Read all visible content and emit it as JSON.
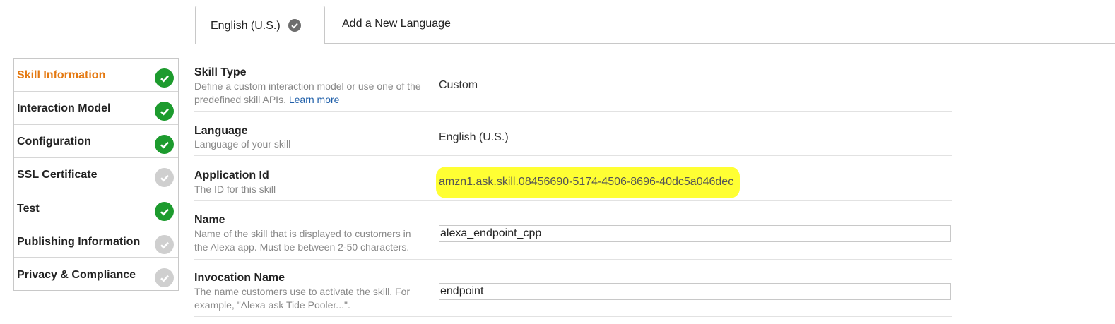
{
  "tabs": {
    "active_label": "English (U.S.)",
    "add_label": "Add a New Language"
  },
  "sidebar": {
    "items": [
      {
        "label": "Skill Information",
        "status": "complete",
        "active": true
      },
      {
        "label": "Interaction Model",
        "status": "complete",
        "active": false
      },
      {
        "label": "Configuration",
        "status": "complete",
        "active": false
      },
      {
        "label": "SSL Certificate",
        "status": "incomplete",
        "active": false
      },
      {
        "label": "Test",
        "status": "complete",
        "active": false
      },
      {
        "label": "Publishing Information",
        "status": "incomplete",
        "active": false
      },
      {
        "label": "Privacy & Compliance",
        "status": "incomplete",
        "active": false
      }
    ]
  },
  "form": {
    "skill_type": {
      "title": "Skill Type",
      "desc_line1": "Define a custom interaction model or use one of the",
      "desc_line2": "predefined skill APIs.",
      "learn_more": "Learn more",
      "value": "Custom"
    },
    "language": {
      "title": "Language",
      "desc": "Language of your skill",
      "value": "English (U.S.)"
    },
    "application_id": {
      "title": "Application Id",
      "desc": "The ID for this skill",
      "value": "amzn1.ask.skill.08456690-5174-4506-8696-40dc5a046dec"
    },
    "name": {
      "title": "Name",
      "desc_line1": "Name of the skill that is displayed to customers in",
      "desc_line2": "the Alexa app. Must be between 2-50 characters.",
      "value": "alexa_endpoint_cpp"
    },
    "invocation_name": {
      "title": "Invocation Name",
      "desc_line1": "The name customers use to activate the skill. For",
      "desc_line2": "example, \"Alexa ask Tide Pooler...\".",
      "value": "endpoint"
    }
  },
  "colors": {
    "active_sidebar": "#e47911",
    "complete": "#1d9b2e",
    "incomplete": "#cfcfcf",
    "highlight": "#ffff33",
    "link": "#1f5fa9"
  }
}
